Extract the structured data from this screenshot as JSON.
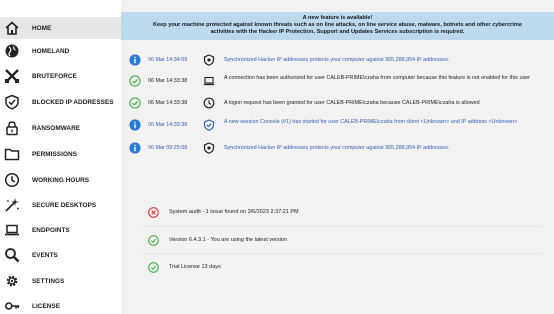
{
  "sidebar": {
    "items": [
      {
        "label": "HOME",
        "icon": "home-icon"
      },
      {
        "label": "HOMELAND",
        "icon": "globe-icon"
      },
      {
        "label": "BRUTEFORCE",
        "icon": "crossed-swords-icon"
      },
      {
        "label": "BLOCKED IP ADDRESSES",
        "icon": "shield-check-icon"
      },
      {
        "label": "RANSOMWARE",
        "icon": "lock-icon"
      },
      {
        "label": "PERMISSIONS",
        "icon": "folder-icon"
      },
      {
        "label": "WORKING HOURS",
        "icon": "clock-icon"
      },
      {
        "label": "SECURE DESKTOPS",
        "icon": "sparkle-icon"
      },
      {
        "label": "ENDPOINTS",
        "icon": "laptop-icon"
      },
      {
        "label": "EVENTS",
        "icon": "search-icon"
      },
      {
        "label": "SETTINGS",
        "icon": "gear-icon"
      },
      {
        "label": "LICENSE",
        "icon": "key-icon"
      }
    ]
  },
  "banner": {
    "title": "A new feature is available!",
    "text": "Keep your machine protected against known threats such as on line attacks, on line service abuse, malware, botnets and other cybercrime activities with the Hacker IP Protection, Support and Updates Services subscription is required."
  },
  "log": [
    {
      "time": "06 Mar 14:34:09",
      "message": "Synchronized Hacker IP addresses protects your computer against 305,288,954 IP addresses.",
      "status": "info",
      "type": "shield"
    },
    {
      "time": "06 Mar 14:33:38",
      "message": "A connection has been authorized for user CALEB-PRIME\\czaha from computer  because this feature is not enabled for this user",
      "status": "ok",
      "type": "computer"
    },
    {
      "time": "06 Mar 14:33:38",
      "message": "A logon request has been granted for user CALEB-PRIME\\czaha because CALEB-PRIME\\czaha is allowed",
      "status": "ok",
      "type": "clock"
    },
    {
      "time": "06 Mar 14:33:38",
      "message": "A new session Console (#1) has started for user CALEB-PRIME\\czaha from client <Unknown> and IP address <Unknown>",
      "status": "info",
      "type": "shield-check"
    },
    {
      "time": "06 Mar 09:25:08",
      "message": "Synchronized Hacker IP addresses protects your computer against 305,288,954 IP addresses.",
      "status": "info",
      "type": "shield"
    }
  ],
  "status": [
    {
      "text": "System audit - 1 issue found on 3/6/2023 2:37:21 PM",
      "state": "error"
    },
    {
      "text": "Version 6.4.3.1 - You are using the latest version",
      "state": "ok"
    },
    {
      "text": "Trial License 13 days",
      "state": "ok"
    }
  ],
  "colors": {
    "banner": "#bcd9ed",
    "info": "#2b7bd1",
    "ok": "#43b04a",
    "error": "#d83a3a",
    "blue_text": "#2f5fb8"
  }
}
